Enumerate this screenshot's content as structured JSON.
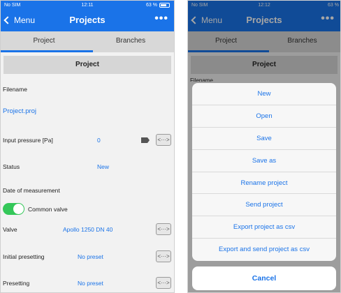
{
  "left": {
    "status": {
      "carrier": "No SIM",
      "time": "12:11",
      "battery": "63 %"
    },
    "nav": {
      "back": "Menu",
      "title": "Projects",
      "more": "•••"
    },
    "tabs": [
      {
        "label": "Project"
      },
      {
        "label": "Branches"
      }
    ],
    "section_title": "Project",
    "rows": {
      "filename_label": "Filename",
      "filename_value": "Project.proj",
      "input_pressure_label": "Input pressure [Pa]",
      "input_pressure_value": "0",
      "status_label": "Status",
      "status_value": "New",
      "date_label": "Date of measurement",
      "common_valve_label": "Common valve",
      "valve_label": "Valve",
      "valve_value": "Apollo 1250 DN 40",
      "initial_presetting_label": "Initial presetting",
      "initial_presetting_value": "No preset",
      "presetting_label": "Presetting",
      "presetting_value": "No preset"
    },
    "arrow_glyph": "<···>"
  },
  "right": {
    "status": {
      "carrier": "No SIM",
      "time": "12:12",
      "battery": "63 %"
    },
    "nav": {
      "back": "Menu",
      "title": "Projects",
      "more": "•••"
    },
    "tabs": [
      {
        "label": "Project"
      },
      {
        "label": "Branches"
      }
    ],
    "section_title": "Project",
    "partial_label": "Filename",
    "actions": [
      {
        "label": "New"
      },
      {
        "label": "Open"
      },
      {
        "label": "Save"
      },
      {
        "label": "Save as"
      },
      {
        "label": "Rename project"
      },
      {
        "label": "Send project"
      },
      {
        "label": "Export project as csv"
      },
      {
        "label": "Export and send project as csv"
      }
    ],
    "cancel": "Cancel"
  },
  "colors": {
    "accent": "#1a73e8",
    "toggle_on": "#34c759"
  }
}
